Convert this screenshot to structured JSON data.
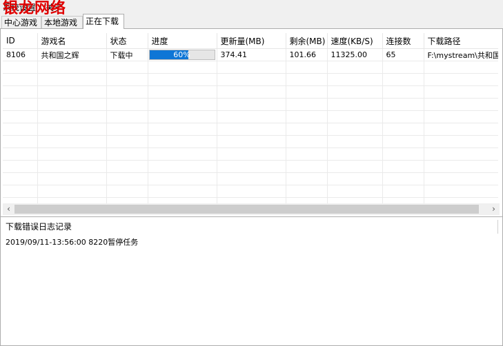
{
  "menubar": {
    "items": [
      "系统设置",
      "关于"
    ]
  },
  "watermark": "银龙网络",
  "tabs": [
    {
      "label": "中心游戏",
      "active": false
    },
    {
      "label": "本地游戏",
      "active": false
    },
    {
      "label": "正在下载",
      "active": true
    }
  ],
  "table": {
    "columns": [
      "ID",
      "游戏名",
      "状态",
      "进度",
      "更新量(MB)",
      "剩余(MB)",
      "速度(KB/S)",
      "连接数",
      "下载路径"
    ],
    "rows": [
      {
        "id": "8106",
        "name": "共和国之辉",
        "status": "下载中",
        "progress": 0.6,
        "progress_label": "60%",
        "update_mb": "374.41",
        "remaining_mb": "101.66",
        "speed": "11325.00",
        "connections": "65",
        "path": "F:\\mystream\\共和国之辉"
      }
    ]
  },
  "scrollbar": {
    "left_arrow": "‹",
    "right_arrow": "›"
  },
  "log": {
    "title": "下载错误日志记录",
    "lines": [
      "2019/09/11-13:56:00 8220暂停任务"
    ]
  },
  "colors": {
    "progress_fill": "#0e76d6",
    "watermark": "#e00000"
  }
}
